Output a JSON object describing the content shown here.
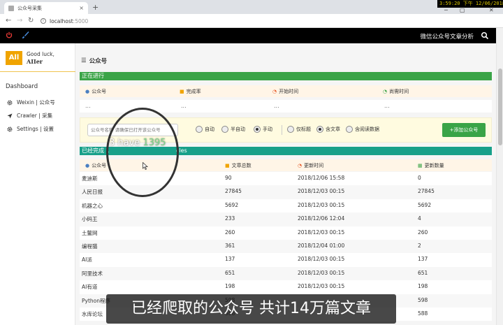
{
  "browser": {
    "tab_title": "公众号采集",
    "tab_close": "×",
    "new_tab": "+",
    "clock": "3:59:20 下午 12/06/2018",
    "url_host": "localhost",
    "url_port": ":5000"
  },
  "navbar": {
    "app_title": "微信公众号文章分析"
  },
  "sidebar": {
    "logo": "All",
    "greeting_line1": "Good luck,",
    "greeting_line2": "AIIer",
    "header": "Dashboard",
    "items": [
      {
        "label": "Weixin | 公众号",
        "icon": "gear-icon"
      },
      {
        "label": "Crawler | 采集",
        "icon": "send-icon"
      },
      {
        "label": "Settings | 设置",
        "icon": "gear-icon"
      }
    ]
  },
  "main": {
    "page_title": "公众号",
    "in_progress": {
      "label": "正在进行",
      "columns": [
        "公众号",
        "完成率",
        "开始时间",
        "尚需时间"
      ],
      "row": [
        "...",
        "...",
        "...",
        "..."
      ]
    },
    "controls": {
      "input_placeholder": "公众号名称 请确保已打开该公众号",
      "modes": [
        {
          "label": "自动",
          "checked": false
        },
        {
          "label": "半自动",
          "checked": false
        },
        {
          "label": "手动",
          "checked": true
        }
      ],
      "scopes": [
        {
          "label": "仅标题",
          "checked": false
        },
        {
          "label": "含文章",
          "checked": true
        },
        {
          "label": "含阅读数据",
          "checked": false
        }
      ],
      "add_button": "+添加公众号"
    },
    "finished": {
      "label": "已经完成 1",
      "label_tail": "cles",
      "columns": [
        "公众号",
        "文章总数",
        "更新时间",
        "更新数量"
      ],
      "rows": [
        [
          "麦迪斯",
          "90",
          "2018/12/06 15:58",
          "0"
        ],
        [
          "人民日报",
          "27845",
          "2018/12/03 00:15",
          "27845"
        ],
        [
          "机器之心",
          "5692",
          "2018/12/03 00:15",
          "5692"
        ],
        [
          "小码王",
          "233",
          "2018/12/06 12:04",
          "4"
        ],
        [
          "土鳖网",
          "260",
          "2018/12/03 00:15",
          "260"
        ],
        [
          "编程猫",
          "361",
          "2018/12/04 01:00",
          "2"
        ],
        [
          "AI派",
          "137",
          "2018/12/03 00:15",
          "137"
        ],
        [
          "阿里技术",
          "651",
          "2018/12/03 00:15",
          "651"
        ],
        [
          "AI有道",
          "198",
          "2018/12/03 00:15",
          "198"
        ],
        [
          "Python程序",
          "598",
          "",
          "598"
        ],
        [
          "水库论坛",
          "588",
          "",
          "588"
        ]
      ]
    }
  },
  "overlay": {
    "prefix": "3 have ",
    "number": "1395"
  },
  "subtitle": "已经爬取的公众号 共计14万篇文章",
  "colors": {
    "green": "#3aa447",
    "teal": "#17a08a",
    "accent_orange": "#f0a400"
  }
}
